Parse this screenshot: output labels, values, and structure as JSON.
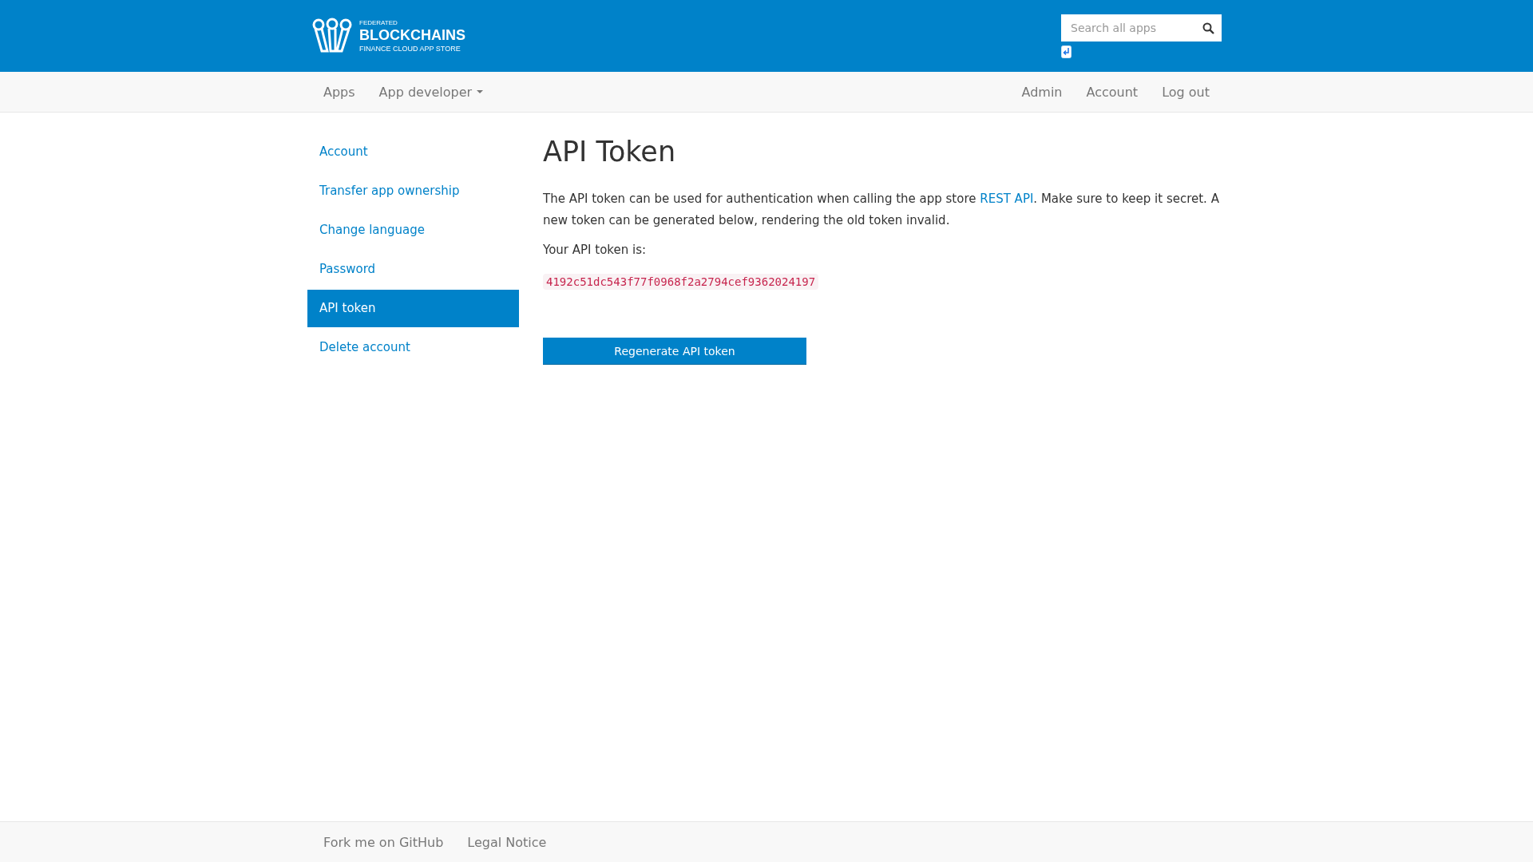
{
  "header": {
    "logo": {
      "lines": [
        "FEDERATED",
        "BLOCKCHAINS",
        "FINANCE CLOUD  APP STORE"
      ]
    },
    "search": {
      "placeholder": "Search all apps"
    }
  },
  "nav": {
    "left": [
      {
        "label": "Apps",
        "kind": "link"
      },
      {
        "label": "App developer",
        "kind": "dropdown"
      }
    ],
    "right": [
      {
        "label": "Admin"
      },
      {
        "label": "Account"
      },
      {
        "label": "Log out"
      }
    ]
  },
  "sidebar": {
    "items": [
      {
        "label": "Account",
        "selected": false
      },
      {
        "label": "Transfer app ownership",
        "selected": false
      },
      {
        "label": "Change language",
        "selected": false
      },
      {
        "label": "Password",
        "selected": false
      },
      {
        "label": "API token",
        "selected": true
      },
      {
        "label": "Delete account",
        "selected": false
      }
    ]
  },
  "main": {
    "title": "API Token",
    "description": {
      "before": "The API token can be used for authentication when calling the app store ",
      "link": "REST API",
      "after": ". Make sure to keep it secret. A new token can be generated below, rendering the old token invalid."
    },
    "token_label": "Your API token is:",
    "token": "4192c51dc543f77f0968f2a2794cef9362024197",
    "button": "Regenerate API token"
  },
  "footer": {
    "links": [
      "Fork me on GitHub",
      "Legal Notice"
    ]
  }
}
